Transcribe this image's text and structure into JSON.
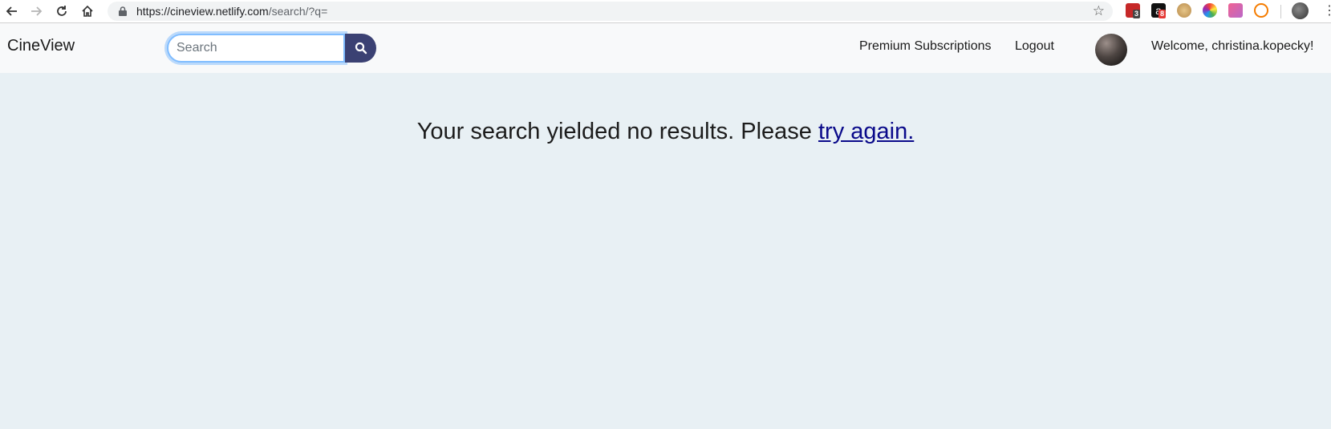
{
  "browser": {
    "url_host": "https://cineview.netlify.com",
    "url_path": "/search/?q=",
    "extension_badges": [
      "3",
      "8"
    ]
  },
  "navbar": {
    "brand": "CineView",
    "search_placeholder": "Search",
    "search_value": "",
    "premium_label": "Premium Subscriptions",
    "logout_label": "Logout",
    "welcome_text": "Welcome, christina.kopecky!"
  },
  "main": {
    "message_text": "Your search yielded no results. Please ",
    "retry_link": "try again."
  },
  "colors": {
    "background": "#e8f0f4",
    "navbar": "#f8f9fa",
    "search_button": "#3b4173",
    "link": "#0a0a8a"
  },
  "icons": [
    "back-arrow-icon",
    "forward-arrow-icon",
    "reload-icon",
    "home-icon",
    "lock-icon",
    "star-icon",
    "search-icon",
    "kebab-menu-icon"
  ]
}
